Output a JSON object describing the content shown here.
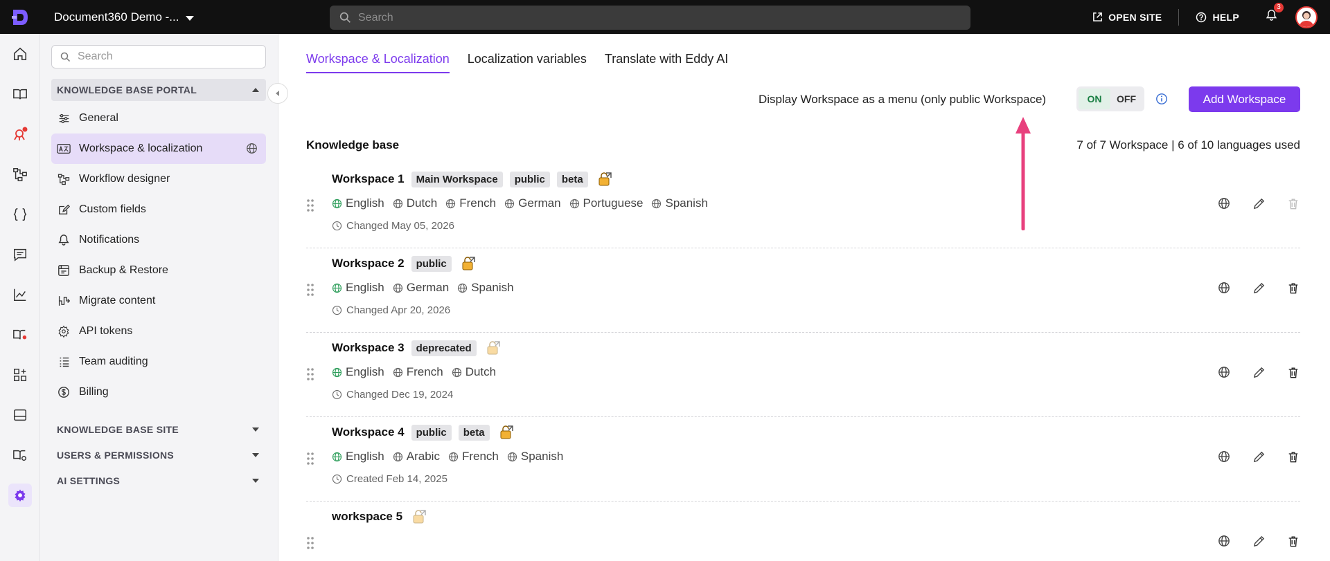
{
  "topbar": {
    "project_name": "Document360 Demo -...",
    "search_placeholder": "Search",
    "open_site": "OPEN SITE",
    "help": "HELP",
    "notification_count": "3"
  },
  "rail": [
    "home-icon",
    "book-icon",
    "drive-icon",
    "workflow-icon",
    "braces-icon",
    "comment-icon",
    "analytics-icon",
    "kb-assistant-icon",
    "widgets-icon",
    "panel-icon",
    "kb-settings-icon",
    "settings-icon"
  ],
  "sidebar": {
    "search_placeholder": "Search",
    "section_portal": "KNOWLEDGE BASE PORTAL",
    "items": [
      {
        "label": "General"
      },
      {
        "label": "Workspace & localization"
      },
      {
        "label": "Workflow designer"
      },
      {
        "label": "Custom fields"
      },
      {
        "label": "Notifications"
      },
      {
        "label": "Backup & Restore"
      },
      {
        "label": "Migrate content"
      },
      {
        "label": "API tokens"
      },
      {
        "label": "Team auditing"
      },
      {
        "label": "Billing"
      }
    ],
    "section_site": "KNOWLEDGE BASE SITE",
    "section_users": "USERS & PERMISSIONS",
    "section_ai": "AI SETTINGS"
  },
  "main": {
    "tabs": [
      "Workspace & Localization",
      "Localization variables",
      "Translate with Eddy AI"
    ],
    "display_label": "Display Workspace as a menu (only public Workspace)",
    "toggle_on": "ON",
    "toggle_off": "OFF",
    "add_button": "Add Workspace",
    "kb_title": "Knowledge base",
    "usage": "7 of 7 Workspace | 6 of 10 languages used",
    "workspaces": [
      {
        "name": "Workspace 1",
        "tags": [
          "Main Workspace",
          "public",
          "beta"
        ],
        "languages": [
          "English",
          "Dutch",
          "French",
          "German",
          "Portuguese",
          "Spanish"
        ],
        "meta": "Changed May 05, 2026"
      },
      {
        "name": "Workspace 2",
        "tags": [
          "public"
        ],
        "languages": [
          "English",
          "German",
          "Spanish"
        ],
        "meta": "Changed Apr 20, 2026"
      },
      {
        "name": "Workspace 3",
        "tags": [
          "deprecated"
        ],
        "languages": [
          "English",
          "French",
          "Dutch"
        ],
        "meta": "Changed Dec 19, 2024"
      },
      {
        "name": "Workspace 4",
        "tags": [
          "public",
          "beta"
        ],
        "languages": [
          "English",
          "Arabic",
          "French",
          "Spanish"
        ],
        "meta": "Created Feb 14, 2025"
      },
      {
        "name": "workspace 5",
        "tags": [],
        "languages": [],
        "meta": ""
      }
    ]
  },
  "colors": {
    "accent": "#7c3aed",
    "annotation_arrow": "#e8407d",
    "topbar": "#111111"
  }
}
